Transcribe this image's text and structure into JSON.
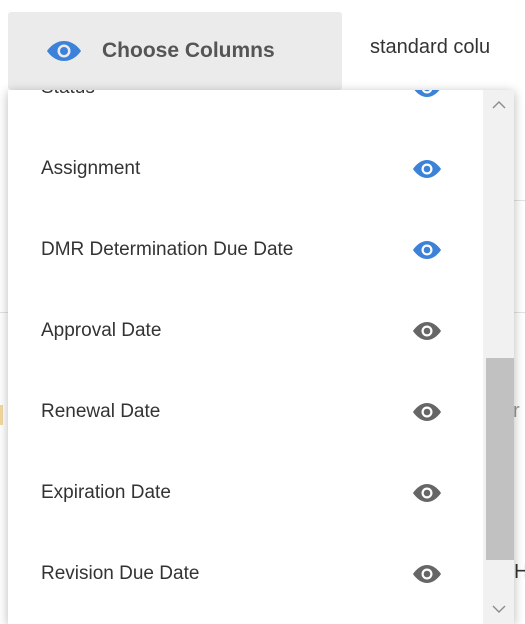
{
  "toolbar": {
    "choose_columns_label": "Choose Columns",
    "choose_columns_icon": "eye-icon",
    "standard_columns_text": "standard colu"
  },
  "columns": {
    "items": [
      {
        "label": "Status",
        "visible": true,
        "icon": "eye-icon"
      },
      {
        "label": "Assignment",
        "visible": true,
        "icon": "eye-icon"
      },
      {
        "label": "DMR Determination Due Date",
        "visible": true,
        "icon": "eye-icon"
      },
      {
        "label": "Approval Date",
        "visible": false,
        "icon": "eye-icon"
      },
      {
        "label": "Renewal Date",
        "visible": false,
        "icon": "eye-icon"
      },
      {
        "label": "Expiration Date",
        "visible": false,
        "icon": "eye-icon"
      },
      {
        "label": "Revision Due Date",
        "visible": false,
        "icon": "eye-icon"
      }
    ]
  },
  "background": {
    "right_marks": [
      "r",
      "H"
    ]
  },
  "colors": {
    "eye_visible": "#3b82d8",
    "eye_hidden": "#666666",
    "button_bg": "#ebebeb",
    "scroll_thumb": "#c1c1c1"
  }
}
